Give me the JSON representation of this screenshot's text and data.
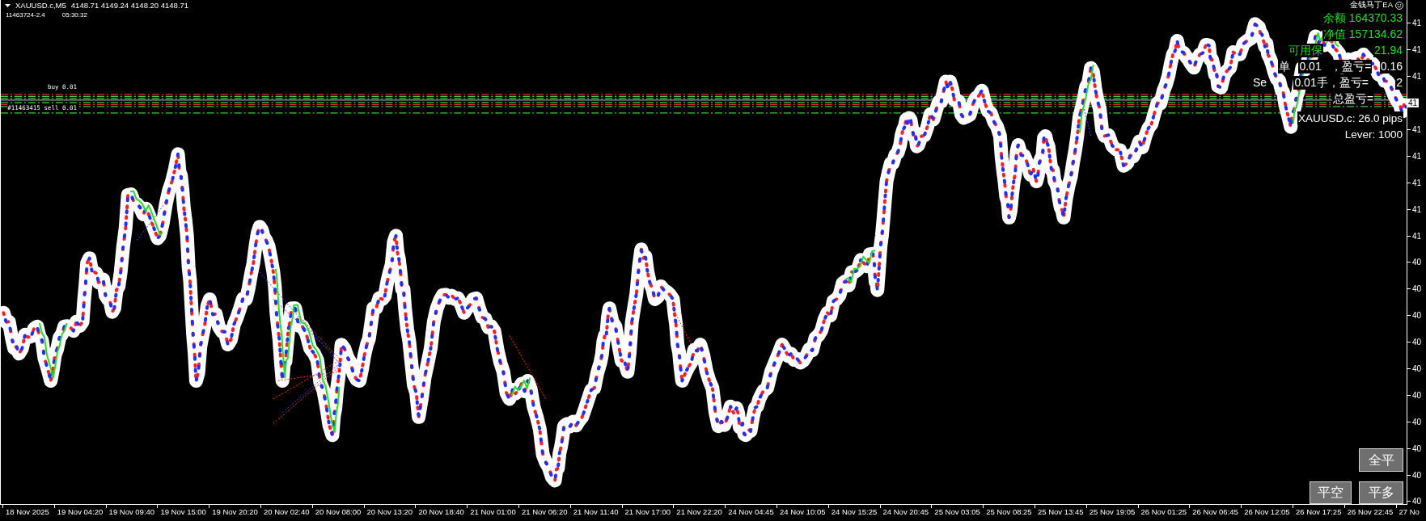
{
  "chart_header": {
    "symbol": "XAUUSD.c,M5",
    "ohlc": "4148.71 4149.24 4148.20 4148.71",
    "account": "11463724-2.4",
    "timer": "05:30:32"
  },
  "order_labels": [
    {
      "text": "buy 0.01"
    },
    {
      "text": "#11463415 sell 0.01"
    }
  ],
  "info_panel": {
    "title": "金钱马丁EA",
    "lines": [
      {
        "color": "#22dd22",
        "parts": [
          "余额 164370.33"
        ]
      },
      {
        "color": "#22dd22",
        "parts": [
          "净值 157134.62"
        ]
      },
      {
        "color": "#22dd22",
        "parts": [
          "可用保",
          "21.94"
        ]
      },
      {
        "color": "#ffffff",
        "parts": [
          "单",
          "0.01",
          "，盈亏=",
          "0.16"
        ]
      },
      {
        "color": "#ffffff",
        "parts": [
          "Se",
          "0.01手，盈亏=",
          "2"
        ]
      },
      {
        "color": "#ffffff",
        "parts": [
          "总盈亏="
        ]
      },
      {
        "color": "#ffffff",
        "parts": [
          "XAUUSD.c: 26.0 pips"
        ]
      },
      {
        "color": "#ffffff",
        "parts": [
          "Lever: 1000"
        ]
      }
    ]
  },
  "buttons": [
    {
      "label": "全平"
    },
    {
      "label": "平空"
    },
    {
      "label": "平多"
    }
  ],
  "price_axis": {
    "labels": [
      {
        "text": "41",
        "kind": "tick"
      },
      {
        "text": "41",
        "kind": "tick"
      },
      {
        "text": "41",
        "kind": "tick"
      },
      {
        "text": "41",
        "kind": "current"
      },
      {
        "text": "41",
        "kind": "tick"
      },
      {
        "text": "41",
        "kind": "tick"
      },
      {
        "text": "41",
        "kind": "tick"
      },
      {
        "text": "41",
        "kind": "tick"
      },
      {
        "text": "41",
        "kind": "tick"
      },
      {
        "text": "40",
        "kind": "tick"
      },
      {
        "text": "40",
        "kind": "tick"
      },
      {
        "text": "40",
        "kind": "tick"
      },
      {
        "text": "40",
        "kind": "tick"
      },
      {
        "text": "40",
        "kind": "tick"
      },
      {
        "text": "40",
        "kind": "tick"
      },
      {
        "text": "40",
        "kind": "tick"
      },
      {
        "text": "40",
        "kind": "tick"
      },
      {
        "text": "40",
        "kind": "tick"
      },
      {
        "text": "40",
        "kind": "tick"
      }
    ]
  },
  "time_axis": {
    "labels": [
      "18 Nov 2025",
      "19 Nov 04:20",
      "19 Nov 09:40",
      "19 Nov 15:00",
      "19 Nov 20:20",
      "20 Nov 02:40",
      "20 Nov 08:00",
      "20 Nov 13:20",
      "20 Nov 18:40",
      "21 Nov 01:00",
      "21 Nov 06:20",
      "21 Nov 11:40",
      "21 Nov 17:00",
      "21 Nov 22:20",
      "24 Nov 04:45",
      "24 Nov 10:05",
      "24 Nov 15:25",
      "24 Nov 20:45",
      "25 Nov 03:05",
      "25 Nov 08:25",
      "25 Nov 13:45",
      "25 Nov 19:05",
      "26 Nov 01:25",
      "26 Nov 06:45",
      "26 Nov 12:05",
      "26 Nov 17:25",
      "26 Nov 22:45",
      "27 No"
    ]
  }
}
